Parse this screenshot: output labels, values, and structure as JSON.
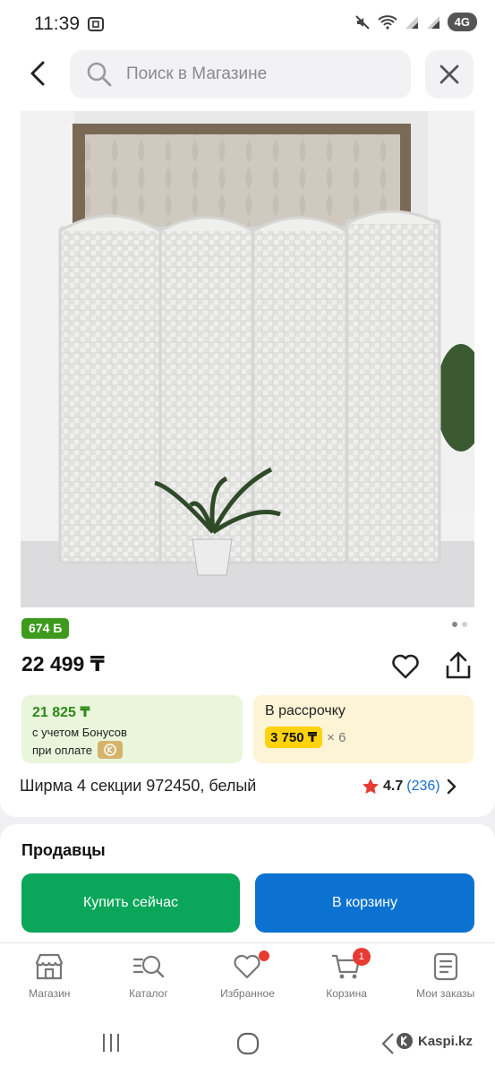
{
  "status": {
    "time": "11:39",
    "network": "4G"
  },
  "search": {
    "placeholder": "Поиск в Магазине"
  },
  "product": {
    "bonus_badge": "674 Б",
    "price": "22 499 ₸",
    "bonus_amount": "21 825 ₸",
    "bonus_desc": "с учетом Бонусов",
    "bonus_pay": "при оплате",
    "installment_title": "В рассрочку",
    "installment_amount": "3 750 ₸",
    "installment_multiplier": "× 6",
    "title": "Ширма 4 секции 972450, белый",
    "rating": "4.7",
    "reviews": "(236)",
    "image_count": 2,
    "image_active": 1
  },
  "sellers": {
    "title": "Продавцы",
    "buy_label": "Купить сейчас",
    "cart_label": "В корзину"
  },
  "tabs": [
    {
      "label": "Магазин",
      "icon": "store-icon"
    },
    {
      "label": "Каталог",
      "icon": "catalog-search-icon"
    },
    {
      "label": "Избранное",
      "icon": "heart-icon"
    },
    {
      "label": "Корзина",
      "icon": "cart-icon",
      "badge": "1"
    },
    {
      "label": "Мои заказы",
      "icon": "orders-icon"
    }
  ],
  "watermark": "Kaspi.kz",
  "colors": {
    "bonus_green": "#3d9a1d",
    "buy_green": "#0aa65a",
    "cart_blue": "#0c72d1",
    "installment_yellow": "#ffd20f",
    "badge_red": "#e63b32",
    "star": "#e63b32"
  }
}
